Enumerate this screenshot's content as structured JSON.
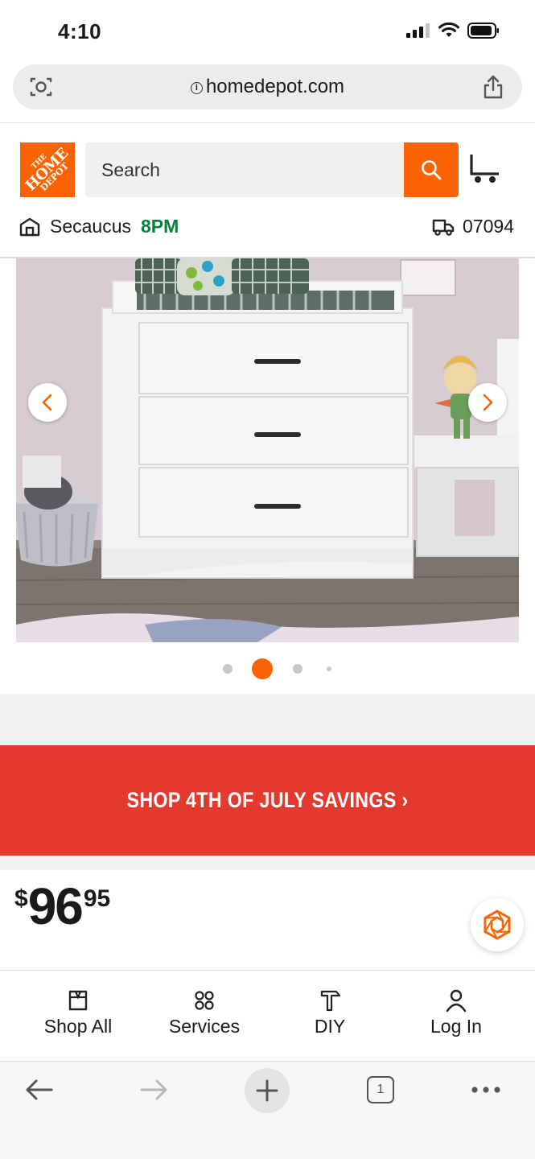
{
  "status_bar": {
    "time": "4:10"
  },
  "browser": {
    "url": "homedepot.com",
    "tab_count": "1"
  },
  "brand": {
    "accent": "#f96302",
    "promo_red": "#e4392e",
    "store_green": "#00823b"
  },
  "header": {
    "logo_line1": "THE",
    "logo_line2": "HOME",
    "logo_line3": "DEPOT",
    "search_placeholder": "Search",
    "store_name": "Secaucus",
    "store_hours": "8PM",
    "zip": "07094"
  },
  "carousel": {
    "dot_count": 4,
    "active_index": 1
  },
  "promo": {
    "text": "SHOP 4TH OF JULY SAVINGS ›"
  },
  "price": {
    "currency": "$",
    "dollars": "96",
    "cents": "95"
  },
  "bottom_nav": {
    "items": [
      {
        "label": "Shop All",
        "icon": "shop-all-icon"
      },
      {
        "label": "Services",
        "icon": "services-icon"
      },
      {
        "label": "DIY",
        "icon": "diy-icon"
      },
      {
        "label": "Log In",
        "icon": "user-icon"
      }
    ]
  }
}
